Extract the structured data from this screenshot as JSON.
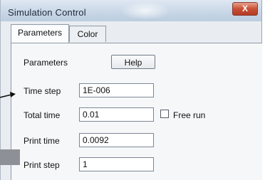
{
  "window": {
    "title": "Simulation Control",
    "close_label": "X"
  },
  "tabs": [
    {
      "label": "Parameters",
      "active": true
    },
    {
      "label": "Color",
      "active": false
    }
  ],
  "panel": {
    "section_label": "Parameters",
    "help_button_label": "Help",
    "fields": {
      "time_step": {
        "label": "Time step",
        "value": "1E-006"
      },
      "total_time": {
        "label": "Total time",
        "value": "0.01"
      },
      "print_time": {
        "label": "Print time",
        "value": "0.0092"
      },
      "print_step": {
        "label": "Print step",
        "value": "1"
      }
    },
    "free_run": {
      "label": "Free run",
      "checked": false
    }
  },
  "icons": {
    "close": "close-icon",
    "arrow": "arrow-right-icon"
  }
}
